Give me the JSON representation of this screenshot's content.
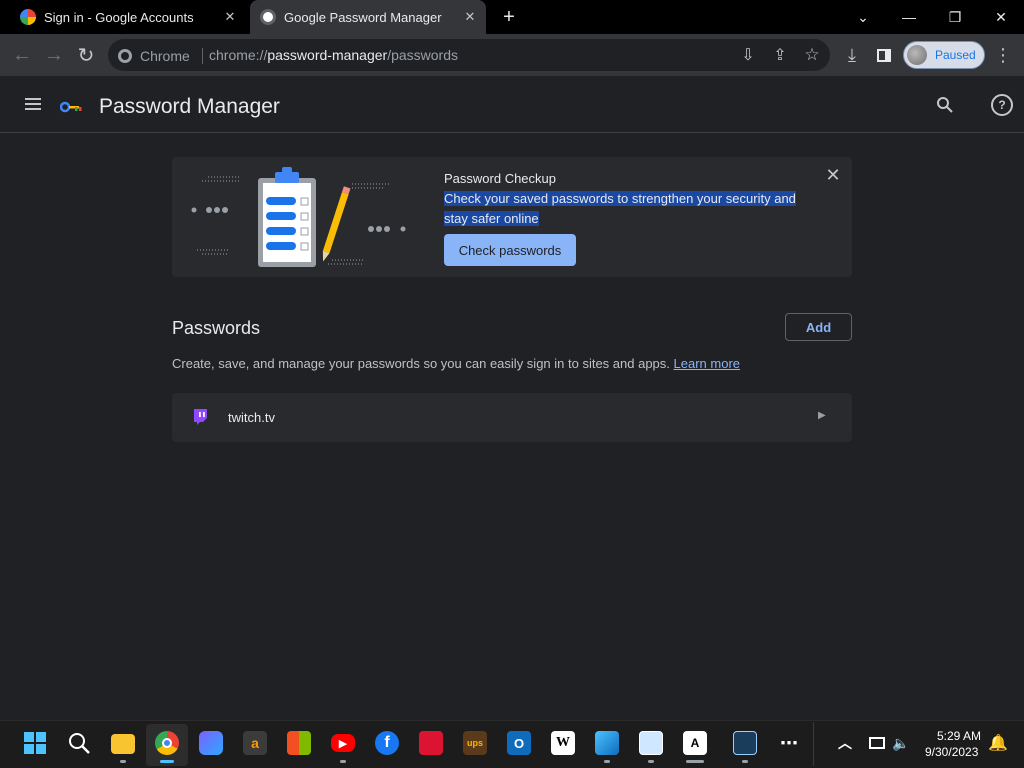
{
  "browser": {
    "tabs": [
      {
        "title": "Sign in - Google Accounts",
        "active": false
      },
      {
        "title": "Google Password Manager",
        "active": true
      }
    ],
    "new_tab_icon": "plus-icon",
    "omnibox": {
      "chip_label": "Chrome",
      "url_prefix": "chrome://",
      "url_host": "password-manager",
      "url_path": "/passwords"
    },
    "profile_label": "Paused"
  },
  "app": {
    "title": "Password Manager",
    "checkup": {
      "title": "Password Checkup",
      "description": "Check your saved passwords to strengthen your security and stay safer online",
      "button": "Check passwords"
    },
    "passwords": {
      "heading": "Passwords",
      "add_button": "Add",
      "description": "Create, save, and manage your passwords so you can easily sign in to sites and apps.",
      "learn_more": "Learn more",
      "items": [
        {
          "site": "twitch.tv",
          "icon": "twitch-icon"
        }
      ]
    }
  },
  "taskbar": {
    "time": "5:29 AM",
    "date": "9/30/2023"
  },
  "colors": {
    "accent": "#8ab4f8",
    "background": "#202124",
    "card": "#292a2d",
    "selection": "#1a48a3"
  }
}
